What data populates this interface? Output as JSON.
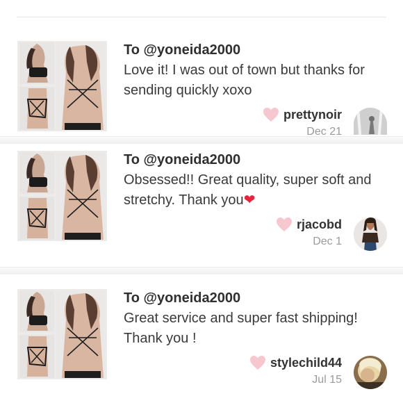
{
  "reviews": [
    {
      "to": "To @yoneida2000",
      "message": "Love it! I was out of town but thanks for sending quickly xoxo",
      "message_emoji": "",
      "username": "prettynoir",
      "date": "Dec 21",
      "avatar_icon": "user-avatar-icon"
    },
    {
      "to": "To @yoneida2000",
      "message": "Obsessed!! Great quality, super soft and stretchy. Thank you",
      "message_emoji": "❤",
      "username": "rjacobd",
      "date": "Dec 1",
      "avatar_icon": "user-avatar-icon"
    },
    {
      "to": "To @yoneida2000",
      "message": "Great service and super fast shipping! Thank you !",
      "message_emoji": "",
      "username": "stylechild44",
      "date": "Jul 15",
      "avatar_icon": "user-avatar-icon"
    }
  ],
  "colors": {
    "heart_light": "#f7c7cf",
    "heart_red": "#e8243d",
    "date_gray": "#9a9a9a",
    "divider": "#e3e6e3"
  }
}
